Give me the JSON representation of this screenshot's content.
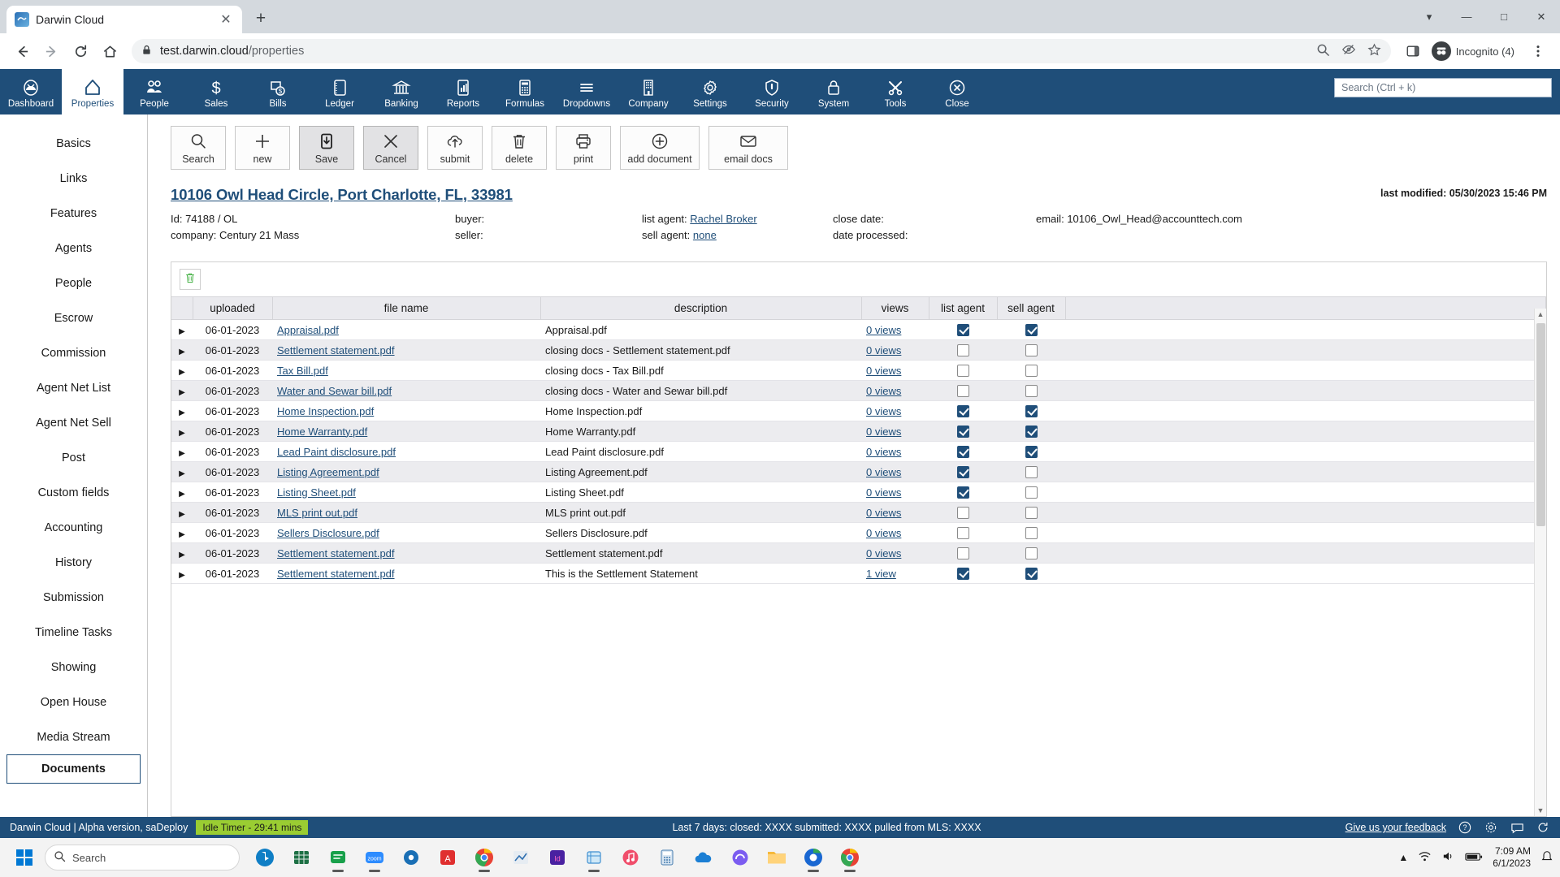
{
  "browser": {
    "tab": {
      "title": "Darwin Cloud",
      "favicon_icon": "darwin-cloud-favicon",
      "close_icon": "close-icon"
    },
    "new_tab_icon": "plus-icon",
    "window_controls": [
      "chevron-down-icon",
      "minimize-icon",
      "maximize-icon",
      "close-icon"
    ],
    "nav": {
      "back_icon": "arrow-left-icon",
      "forward_icon": "arrow-right-icon",
      "reload_icon": "reload-icon",
      "home_icon": "home-icon"
    },
    "omnibox": {
      "lock_icon": "lock-icon",
      "host": "test.darwin.cloud",
      "path": "/properties",
      "zoom_icon": "search-zoom-icon",
      "tracking_icon": "eye-slash-icon",
      "bookmark_icon": "star-icon",
      "sidepanel_icon": "side-panel-icon",
      "menu_icon": "kebab-menu-icon"
    },
    "profile": {
      "avatar_icon": "incognito-avatar-icon",
      "label": "Incognito (4)"
    }
  },
  "appnav": {
    "items": [
      {
        "label": "Dashboard",
        "icon": "gauge-icon",
        "active": false
      },
      {
        "label": "Properties",
        "icon": "house-icon",
        "active": true
      },
      {
        "label": "People",
        "icon": "people-icon",
        "active": false
      },
      {
        "label": "Sales",
        "icon": "dollar-icon",
        "active": false
      },
      {
        "label": "Bills",
        "icon": "bill-money-icon",
        "active": false
      },
      {
        "label": "Ledger",
        "icon": "ledger-book-icon",
        "active": false
      },
      {
        "label": "Banking",
        "icon": "bank-icon",
        "active": false
      },
      {
        "label": "Reports",
        "icon": "bar-chart-icon",
        "active": false
      },
      {
        "label": "Formulas",
        "icon": "calculator-icon",
        "active": false
      },
      {
        "label": "Dropdowns",
        "icon": "list-lines-icon",
        "active": false
      },
      {
        "label": "Company",
        "icon": "building-icon",
        "active": false
      },
      {
        "label": "Settings",
        "icon": "gear-icon",
        "active": false
      },
      {
        "label": "Security",
        "icon": "shield-icon",
        "active": false
      },
      {
        "label": "System",
        "icon": "lock-icon",
        "active": false
      },
      {
        "label": "Tools",
        "icon": "tools-icon",
        "active": false
      },
      {
        "label": "Close",
        "icon": "close-circle-icon",
        "active": false
      }
    ],
    "search_placeholder": "Search (Ctrl + k)"
  },
  "sidebar": {
    "items": [
      {
        "label": "Basics",
        "active": false
      },
      {
        "label": "Links",
        "active": false
      },
      {
        "label": "Features",
        "active": false
      },
      {
        "label": "Agents",
        "active": false
      },
      {
        "label": "People",
        "active": false
      },
      {
        "label": "Escrow",
        "active": false
      },
      {
        "label": "Commission",
        "active": false
      },
      {
        "label": "Agent Net List",
        "active": false
      },
      {
        "label": "Agent Net Sell",
        "active": false
      },
      {
        "label": "Post",
        "active": false
      },
      {
        "label": "Custom fields",
        "active": false
      },
      {
        "label": "Accounting",
        "active": false
      },
      {
        "label": "History",
        "active": false
      },
      {
        "label": "Submission",
        "active": false
      },
      {
        "label": "Timeline Tasks",
        "active": false
      },
      {
        "label": "Showing",
        "active": false
      },
      {
        "label": "Open House",
        "active": false
      },
      {
        "label": "Media Stream",
        "active": false
      },
      {
        "label": "Documents",
        "active": true
      }
    ]
  },
  "actionbar": {
    "buttons": [
      {
        "label": "Search",
        "icon": "magnifier-icon",
        "pressed": false,
        "wide": false
      },
      {
        "label": "new",
        "icon": "plus-icon",
        "pressed": false,
        "wide": false
      },
      {
        "label": "Save",
        "icon": "save-download-icon",
        "pressed": true,
        "wide": false
      },
      {
        "label": "Cancel",
        "icon": "x-icon",
        "pressed": true,
        "wide": false
      },
      {
        "label": "submit",
        "icon": "cloud-upload-icon",
        "pressed": false,
        "wide": false
      },
      {
        "label": "delete",
        "icon": "trash-icon",
        "pressed": false,
        "wide": false
      },
      {
        "label": "print",
        "icon": "printer-icon",
        "pressed": false,
        "wide": false
      },
      {
        "label": "add document",
        "icon": "plus-circle-icon",
        "pressed": false,
        "wide": true
      },
      {
        "label": "email docs",
        "icon": "envelope-icon",
        "pressed": false,
        "wide": true
      }
    ]
  },
  "property": {
    "address": "10106 Owl Head Circle, Port Charlotte, FL, 33981",
    "last_modified": "last modified: 05/30/2023 15:46 PM",
    "id_label": "Id: 74188 / OL",
    "company_label": "company: Century 21 Mass",
    "buyer_label": "buyer:",
    "seller_label": "seller:",
    "list_agent_label": "list agent:",
    "list_agent_value": "Rachel Broker",
    "sell_agent_label": "sell agent:",
    "sell_agent_value": "none",
    "close_date_label": "close date:",
    "date_processed_label": "date processed:",
    "email_label": "email:",
    "email_value": "10106_Owl_Head@accounttech.com"
  },
  "documents_table": {
    "delete_icon": "trash-green-icon",
    "columns": [
      "",
      "uploaded",
      "file name",
      "description",
      "views",
      "list agent",
      "sell agent",
      ""
    ],
    "rows": [
      {
        "expand": "▶",
        "uploaded": "06-01-2023",
        "file": "Appraisal.pdf",
        "description": "Appraisal.pdf",
        "views": "0 views",
        "list_agent": true,
        "sell_agent": true
      },
      {
        "expand": "▶",
        "uploaded": "06-01-2023",
        "file": "Settlement statement.pdf",
        "description": "closing docs - Settlement statement.pdf",
        "views": "0 views",
        "list_agent": false,
        "sell_agent": false
      },
      {
        "expand": "▶",
        "uploaded": "06-01-2023",
        "file": "Tax Bill.pdf",
        "description": "closing docs - Tax Bill.pdf",
        "views": "0 views",
        "list_agent": false,
        "sell_agent": false
      },
      {
        "expand": "▶",
        "uploaded": "06-01-2023",
        "file": "Water and Sewar bill.pdf",
        "description": "closing docs - Water and Sewar bill.pdf",
        "views": "0 views",
        "list_agent": false,
        "sell_agent": false
      },
      {
        "expand": "▶",
        "uploaded": "06-01-2023",
        "file": "Home Inspection.pdf",
        "description": "Home Inspection.pdf",
        "views": "0 views",
        "list_agent": true,
        "sell_agent": true
      },
      {
        "expand": "▶",
        "uploaded": "06-01-2023",
        "file": "Home Warranty.pdf",
        "description": "Home Warranty.pdf",
        "views": "0 views",
        "list_agent": true,
        "sell_agent": true
      },
      {
        "expand": "▶",
        "uploaded": "06-01-2023",
        "file": "Lead Paint disclosure.pdf",
        "description": "Lead Paint disclosure.pdf",
        "views": "0 views",
        "list_agent": true,
        "sell_agent": true
      },
      {
        "expand": "▶",
        "uploaded": "06-01-2023",
        "file": "Listing Agreement.pdf",
        "description": "Listing Agreement.pdf",
        "views": "0 views",
        "list_agent": true,
        "sell_agent": false
      },
      {
        "expand": "▶",
        "uploaded": "06-01-2023",
        "file": "Listing Sheet.pdf",
        "description": "Listing Sheet.pdf",
        "views": "0 views",
        "list_agent": true,
        "sell_agent": false
      },
      {
        "expand": "▶",
        "uploaded": "06-01-2023",
        "file": "MLS print out.pdf",
        "description": "MLS print out.pdf",
        "views": "0 views",
        "list_agent": false,
        "sell_agent": false
      },
      {
        "expand": "▶",
        "uploaded": "06-01-2023",
        "file": "Sellers Disclosure.pdf",
        "description": "Sellers Disclosure.pdf",
        "views": "0 views",
        "list_agent": false,
        "sell_agent": false
      },
      {
        "expand": "▶",
        "uploaded": "06-01-2023",
        "file": "Settlement statement.pdf",
        "description": "Settlement statement.pdf",
        "views": "0 views",
        "list_agent": false,
        "sell_agent": false
      },
      {
        "expand": "▶",
        "uploaded": "06-01-2023",
        "file": "Settlement statement.pdf",
        "description": "This is the Settlement Statement",
        "views": "1 view",
        "list_agent": true,
        "sell_agent": true
      }
    ]
  },
  "statusbar": {
    "left": "Darwin Cloud | Alpha version, saDeploy",
    "idle_timer": "Idle Timer - 29:41 mins",
    "center": "Last 7 days: closed: XXXX submitted: XXXX pulled from MLS: XXXX",
    "feedback": "Give us your feedback",
    "icons": [
      "help-circle-icon",
      "gear-icon",
      "chat-icon",
      "refresh-icon"
    ],
    "accent": "#1f4e79"
  },
  "taskbar": {
    "start_icon": "windows-start-icon",
    "search_placeholder": "Search",
    "search_icon": "search-icon",
    "apps": [
      "bing-icon",
      "excel-icon",
      "messaging-green-icon",
      "zoom-icon",
      "settings-blue-icon",
      "acrobat-icon",
      "chrome-icon",
      "analytics-icon",
      "indesign-icon",
      "snip-sketch-icon",
      "music-icon",
      "calculator-icon",
      "onedrive-icon",
      "edge-copilot-icon",
      "file-explorer-icon",
      "chrome-beta-icon",
      "chrome-canary-icon"
    ],
    "tray": {
      "chevron_icon": "chevron-up-icon",
      "wifi_icon": "wifi-icon",
      "volume_icon": "volume-icon",
      "battery_icon": "battery-icon"
    },
    "clock_time": "7:09 AM",
    "clock_date": "6/1/2023"
  }
}
